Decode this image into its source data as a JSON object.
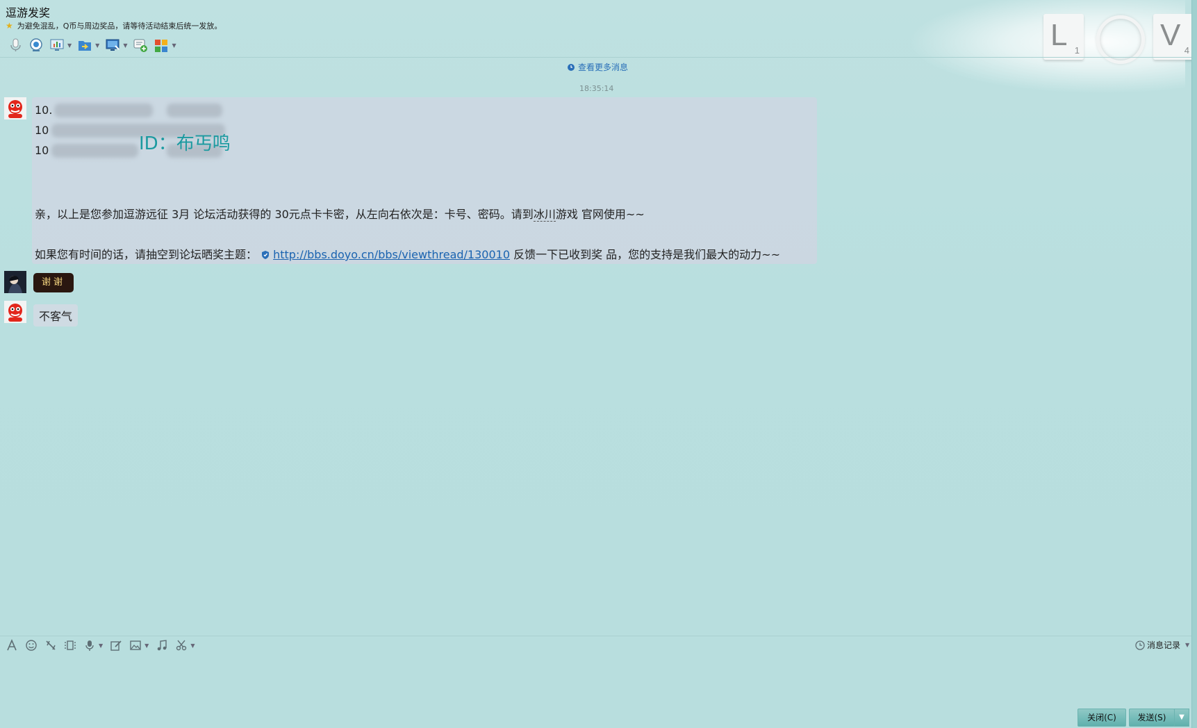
{
  "window": {
    "title": "逗游发奖",
    "notice": "为避免混乱，Q币与周边奖品，请等待活动结束后统一发放。",
    "decor_tiles": [
      {
        "letter": "L",
        "sub": "1"
      },
      {
        "letter": "V",
        "sub": "4"
      }
    ]
  },
  "toolbar": {
    "icons": [
      "voice-call-icon",
      "video-call-icon",
      "remote-desktop-icon",
      "file-transfer-icon",
      "screen-share-icon",
      "create-discussion-icon",
      "apps-icon"
    ]
  },
  "chat": {
    "more_messages": "查看更多消息",
    "timestamp": "18:35:14",
    "message1": {
      "line1_prefix": "10.",
      "line2_prefix": "10",
      "line3_prefix": "10",
      "watermark_id": "ID：布丐鸣",
      "body_before_highlight": "亲，以上是您参加逗游远征 3月 论坛活动获得的 30元点卡卡密，从左向右依次是：卡号、密码。请到",
      "highlight": "冰川",
      "body_after_highlight": "游戏 官网使用~~",
      "feedback_prefix": "如果您有时间的话，请抽空到论坛晒奖主题：",
      "link": "http://bbs.doyo.cn/bbs/viewthread/130010",
      "feedback_suffix": " 反馈一下已收到奖 品，您的支持是我们最大的动力~~"
    },
    "message2": "谢谢",
    "message3": "不客气"
  },
  "input_toolbar": {
    "history_label": "消息记录"
  },
  "buttons": {
    "close": "关闭(C)",
    "send": "发送(S)"
  },
  "colors": {
    "background": "#b9dfdf",
    "link": "#1a63b0",
    "watermark": "#1b9aa0",
    "button": "#6fb9b5"
  }
}
